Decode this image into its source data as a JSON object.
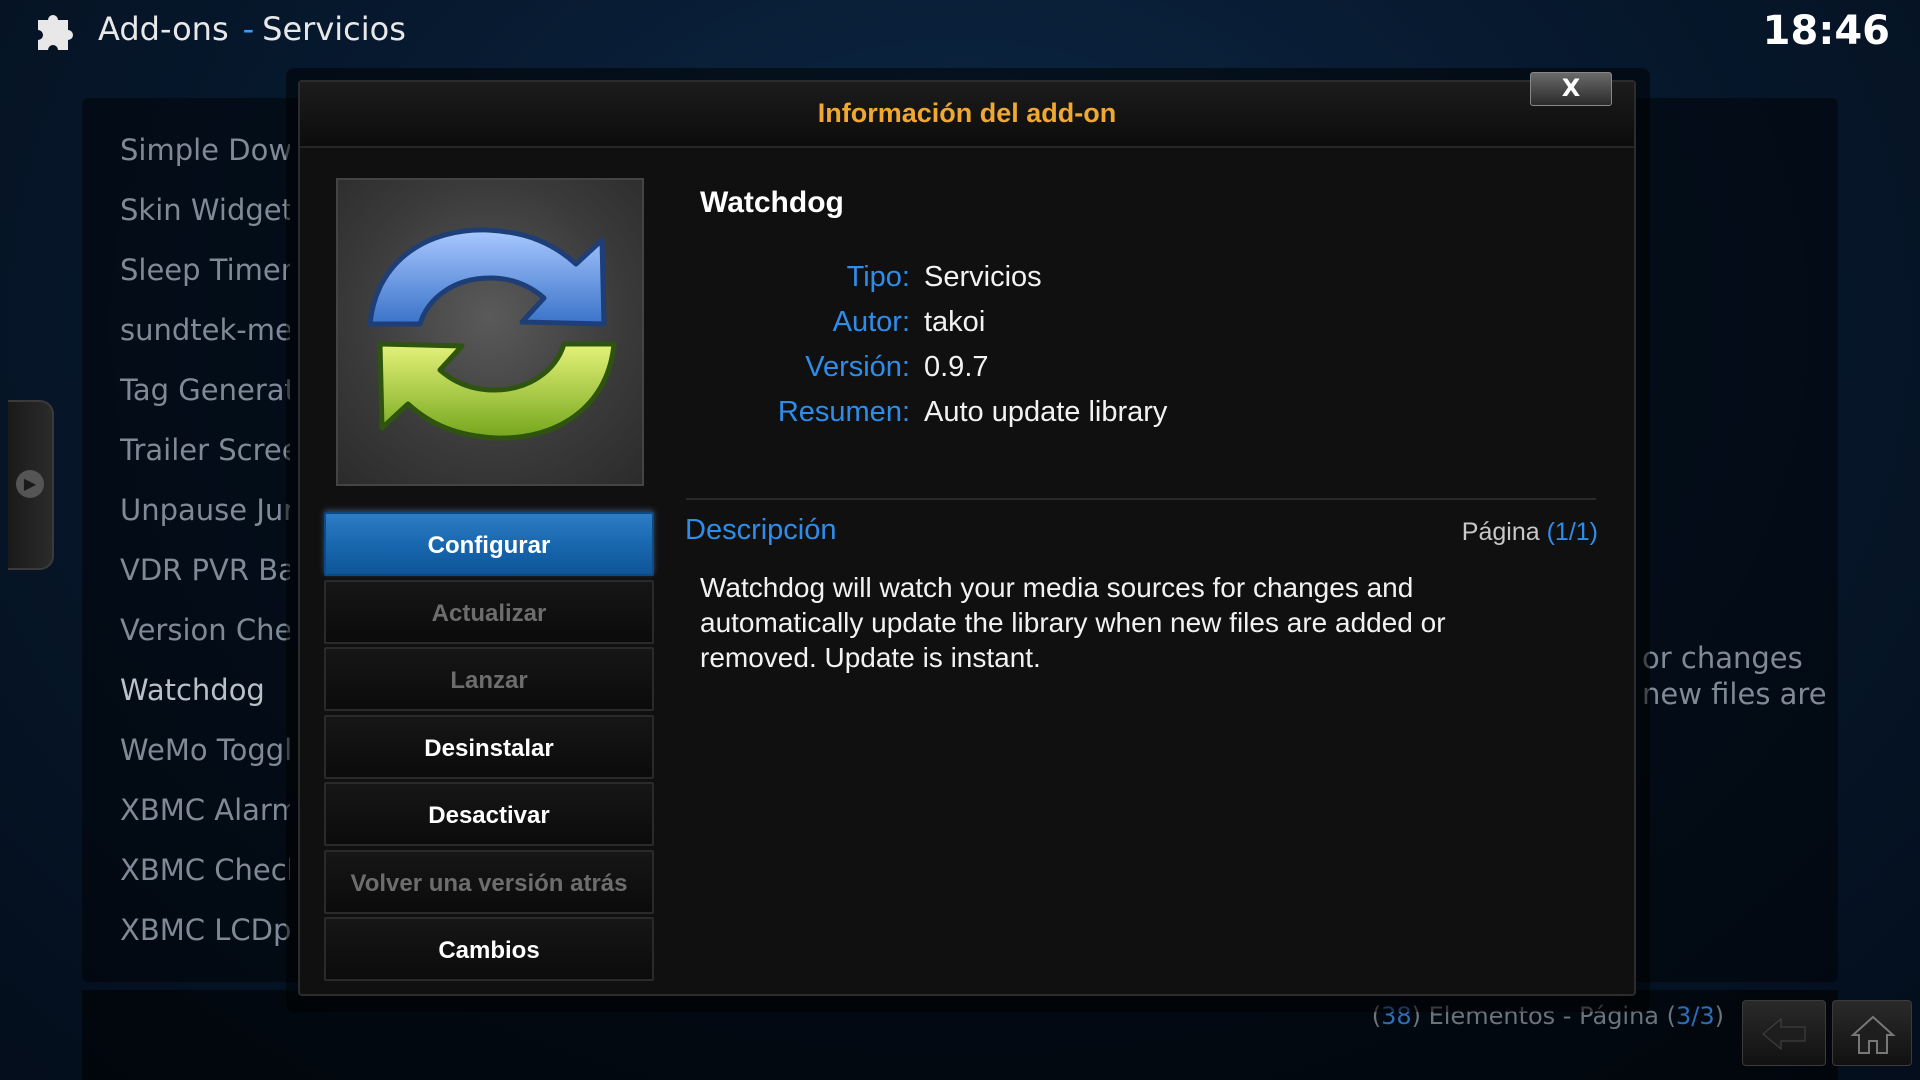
{
  "header": {
    "section": "Add-ons",
    "separator": "-",
    "subsection": "Servicios",
    "clock": "18:46"
  },
  "background_list": {
    "items": [
      "Simple Downloader",
      "Skin Widgets",
      "Sleep Timer",
      "sundtek-mediatv",
      "Tag Generator",
      "Trailer Screensaver",
      "Unpause Jumpback",
      "VDR PVR Backend",
      "Version Check",
      "Watchdog",
      "WeMo Toggle",
      "XBMC Alarm",
      "XBMC Check",
      "XBMC LCDproc"
    ],
    "active_index": 9,
    "description_fragment_1": "or changes",
    "description_fragment_2": "new files are"
  },
  "footer": {
    "count_open": "(",
    "count": "38",
    "count_text": ") Elementos - Página (",
    "page": "3/3",
    "page_close": ")"
  },
  "dialog": {
    "title": "Información del add-on",
    "close_label": "X",
    "addon_name": "Watchdog",
    "info": [
      {
        "key": "Tipo:",
        "value": "Servicios"
      },
      {
        "key": "Autor:",
        "value": "takoi"
      },
      {
        "key": "Versión:",
        "value": "0.9.7"
      },
      {
        "key": "Resumen:",
        "value": "Auto update library"
      }
    ],
    "description_heading": "Descripción",
    "page_label": "Página",
    "page_value": "(1/1)",
    "description": "Watchdog will watch your media sources for changes and automatically update the library when new files are added or removed. Update is instant.",
    "buttons": [
      {
        "label": "Configurar",
        "state": "focused"
      },
      {
        "label": "Actualizar",
        "state": "disabled"
      },
      {
        "label": "Lanzar",
        "state": "disabled"
      },
      {
        "label": "Desinstalar",
        "state": "enabled"
      },
      {
        "label": "Desactivar",
        "state": "enabled"
      },
      {
        "label": "Volver una versión atrás",
        "state": "disabled"
      },
      {
        "label": "Cambios",
        "state": "enabled"
      }
    ]
  },
  "colors": {
    "accent_blue": "#2e8dea",
    "title_orange": "#f0a830",
    "focus_blue": "#1766ad"
  },
  "icons": [
    "puzzle-icon",
    "chevron-right-icon",
    "close-icon",
    "refresh-icon",
    "back-arrow-icon",
    "home-icon"
  ]
}
